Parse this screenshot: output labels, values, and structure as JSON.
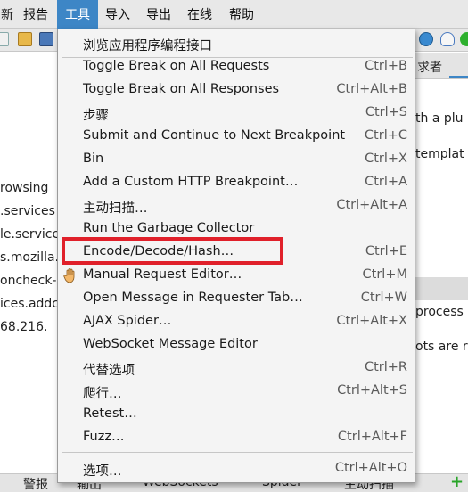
{
  "menubar": {
    "items": [
      "新",
      "报告",
      "工具",
      "导入",
      "导出",
      "在线",
      "帮助"
    ]
  },
  "left_panel": {
    "lines": [
      "rowsing",
      ".services",
      "le.service",
      "s.mozilla.",
      "oncheck-",
      "ices.addc",
      "68.216."
    ]
  },
  "right_panel": {
    "tab_label": "求者",
    "lines": [
      "th a plu",
      "templat",
      "process",
      "ots are r"
    ]
  },
  "bottom_tabs": [
    "警报",
    "输出",
    "WebSockets",
    "Spider",
    "主动扫描"
  ],
  "menu": {
    "items": [
      {
        "label": "浏览应用程序编程接口",
        "shortcut": ""
      },
      {
        "label": "Toggle Break on All Requests",
        "shortcut": "Ctrl+B"
      },
      {
        "label": "Toggle Break on All Responses",
        "shortcut": "Ctrl+Alt+B"
      },
      {
        "label": "步骤",
        "shortcut": "Ctrl+S"
      },
      {
        "label": "Submit and Continue to Next Breakpoint",
        "shortcut": "Ctrl+C"
      },
      {
        "label": "Bin",
        "shortcut": "Ctrl+X"
      },
      {
        "label": "Add a Custom HTTP Breakpoint…",
        "shortcut": "Ctrl+A"
      },
      {
        "label": "主动扫描…",
        "shortcut": "Ctrl+Alt+A"
      },
      {
        "label": "Run the Garbage Collector",
        "shortcut": ""
      },
      {
        "label": "Encode/Decode/Hash…",
        "shortcut": "Ctrl+E"
      },
      {
        "label": "Manual Request Editor…",
        "shortcut": "Ctrl+M"
      },
      {
        "label": "Open Message in Requester Tab…",
        "shortcut": "Ctrl+W"
      },
      {
        "label": "AJAX Spider…",
        "shortcut": "Ctrl+Alt+X"
      },
      {
        "label": "WebSocket Message Editor",
        "shortcut": ""
      },
      {
        "label": "代替选项",
        "shortcut": "Ctrl+R"
      },
      {
        "label": "爬行…",
        "shortcut": "Ctrl+Alt+S"
      },
      {
        "label": "Retest…",
        "shortcut": ""
      },
      {
        "label": "Fuzz…",
        "shortcut": "Ctrl+Alt+F"
      },
      {
        "label": "选项…",
        "shortcut": "Ctrl+Alt+O"
      }
    ]
  },
  "colors": {
    "accent": "#3d86c6",
    "highlight_box": "#e0202a"
  }
}
